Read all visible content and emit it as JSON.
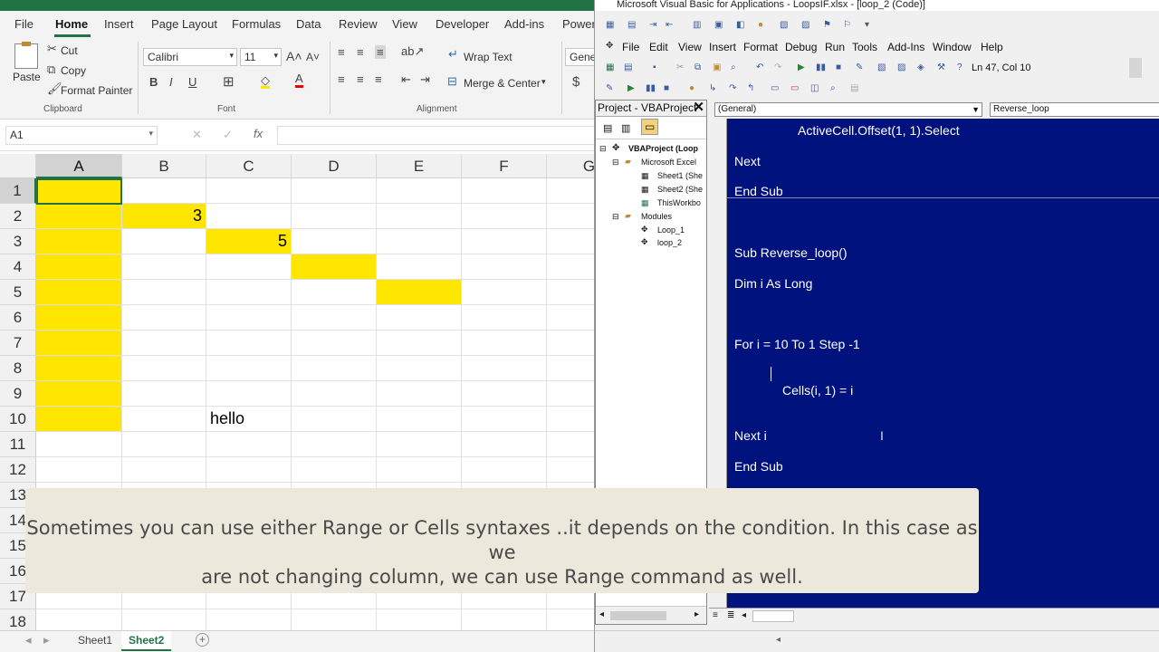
{
  "excel": {
    "tabs": [
      "File",
      "Home",
      "Insert",
      "Page Layout",
      "Formulas",
      "Data",
      "Review",
      "View",
      "Developer",
      "Add-ins",
      "Power"
    ],
    "active_tab": "Home",
    "clipboard": {
      "paste": "Paste",
      "cut": "Cut",
      "copy": "Copy",
      "format_painter": "Format Painter",
      "group": "Clipboard"
    },
    "font": {
      "name": "Calibri",
      "size": "11",
      "group": "Font"
    },
    "alignment": {
      "wrap": "Wrap Text",
      "merge": "Merge & Center",
      "group": "Alignment"
    },
    "number": {
      "format": "Gener"
    },
    "name_box": "A1",
    "fx": "fx",
    "columns": [
      "A",
      "B",
      "C",
      "D",
      "E",
      "F",
      "G"
    ],
    "rows": [
      "1",
      "2",
      "3",
      "4",
      "5",
      "6",
      "7",
      "8",
      "9",
      "10",
      "11",
      "12",
      "13",
      "14",
      "15",
      "16",
      "17",
      "18"
    ],
    "cells": {
      "B2": "3",
      "C3": "5",
      "C10": "hello"
    },
    "sheets": [
      "Sheet1",
      "Sheet2"
    ],
    "active_sheet": "Sheet2",
    "accent": "#217346",
    "highlight": "#ffe600"
  },
  "vba": {
    "title": "Microsoft Visual Basic for Applications - LoopsIF.xlsx - [loop_2 (Code)]",
    "menu": [
      "File",
      "Edit",
      "View",
      "Insert",
      "Format",
      "Debug",
      "Run",
      "Tools",
      "Add-Ins",
      "Window",
      "Help"
    ],
    "status": "Ln 47, Col 10",
    "project_title": "Project - VBAProject",
    "tree": {
      "root": "VBAProject (Loop",
      "excel_objects": "Microsoft Excel",
      "sheet1": "Sheet1 (She",
      "sheet2": "Sheet2 (She",
      "thisworkbook": "ThisWorkbo",
      "modules": "Modules",
      "loop1": "Loop_1",
      "loop2": "loop_2"
    },
    "combo_object": "(General)",
    "combo_proc": "Reverse_loop",
    "code_lines": {
      "l1": "ActiveCell.Offset(1, 1).Select",
      "l2": "Next",
      "l3": "End Sub",
      "l4": "Sub Reverse_loop()",
      "l5": "Dim i As Long",
      "l6": "For i = 10 To 1 Step -1",
      "l7": "Cells(i, 1) = i",
      "l8": "Next i",
      "l9": "End Sub"
    },
    "code_bg": "#00127e"
  },
  "caption": {
    "line1": "Sometimes you can use either Range or Cells syntaxes ..it depends on  the condition. In this case as we",
    "line2": "are not changing column, we can use Range command as well."
  }
}
